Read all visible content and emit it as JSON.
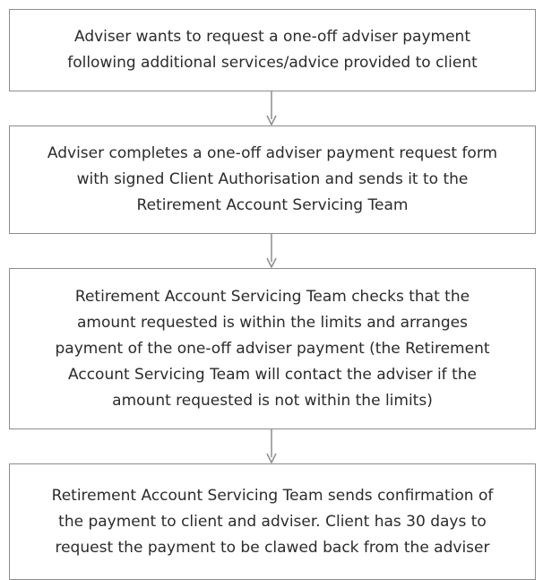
{
  "flowchart": {
    "steps": [
      {
        "text": "Adviser wants to request a one-off adviser payment\nfollowing additional services/advice provided to client"
      },
      {
        "text": "Adviser completes a one-off adviser payment request form\nwith signed Client Authorisation and sends it to the\nRetirement Account Servicing Team"
      },
      {
        "text": "Retirement Account Servicing Team checks that the\namount requested is within the limits and arranges\npayment of the one-off adviser payment (the Retirement\nAccount Servicing Team will contact the adviser if the\namount requested is not within the limits)"
      },
      {
        "text": "Retirement Account Servicing Team sends confirmation of\nthe payment to client and adviser. Client has 30 days to\nrequest the payment to be clawed back from the adviser"
      }
    ],
    "colors": {
      "box_border": "#8c8c8c",
      "arrow": "#8c8c8c",
      "text": "#2b2b2b"
    }
  }
}
